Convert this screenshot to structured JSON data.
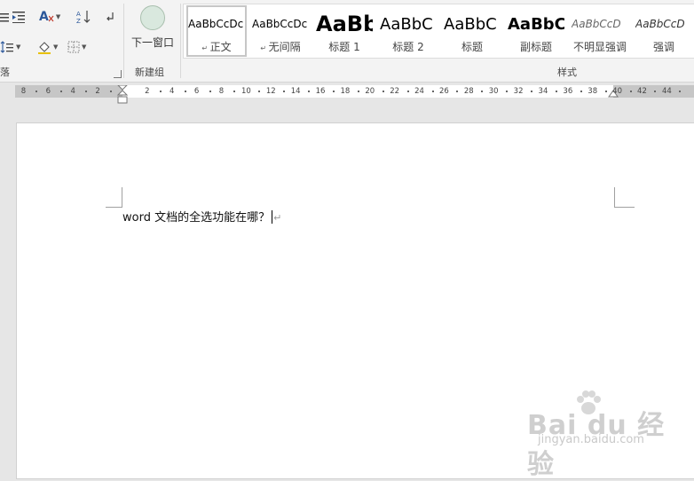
{
  "ribbon": {
    "paragraph_group_label": "落",
    "new_group_label": "新建组",
    "next_window_label": "下一窗口",
    "styles_group_label": "样式"
  },
  "styles": [
    {
      "preview": "AaBbCcDc",
      "name": "正文",
      "selected": true
    },
    {
      "preview": "AaBbCcDc",
      "name": "无间隔"
    },
    {
      "preview": "AaBb",
      "name": "标题 1"
    },
    {
      "preview": "AaBbC",
      "name": "标题 2"
    },
    {
      "preview": "AaBbC",
      "name": "标题"
    },
    {
      "preview": "AaBbC",
      "name": "副标题"
    },
    {
      "preview": "AaBbCcD",
      "name": "不明显强调"
    },
    {
      "preview": "AaBbCcD",
      "name": "强调"
    }
  ],
  "ruler": {
    "labels": [
      "8",
      "6",
      "4",
      "2",
      "2",
      "4",
      "6",
      "8",
      "10",
      "12",
      "14",
      "16",
      "18",
      "20",
      "22",
      "24",
      "26",
      "28",
      "30",
      "32",
      "34",
      "36",
      "38",
      "40",
      "42",
      "44"
    ]
  },
  "document": {
    "text": "word 文档的全选功能在哪？"
  },
  "watermark": {
    "logo": "Bai du 经验",
    "url": "jingyan.baidu.com"
  },
  "colors": {
    "accent": "#2b579a",
    "ribbon_bg": "#f3f3f3",
    "workspace_bg": "#e6e6e6"
  }
}
